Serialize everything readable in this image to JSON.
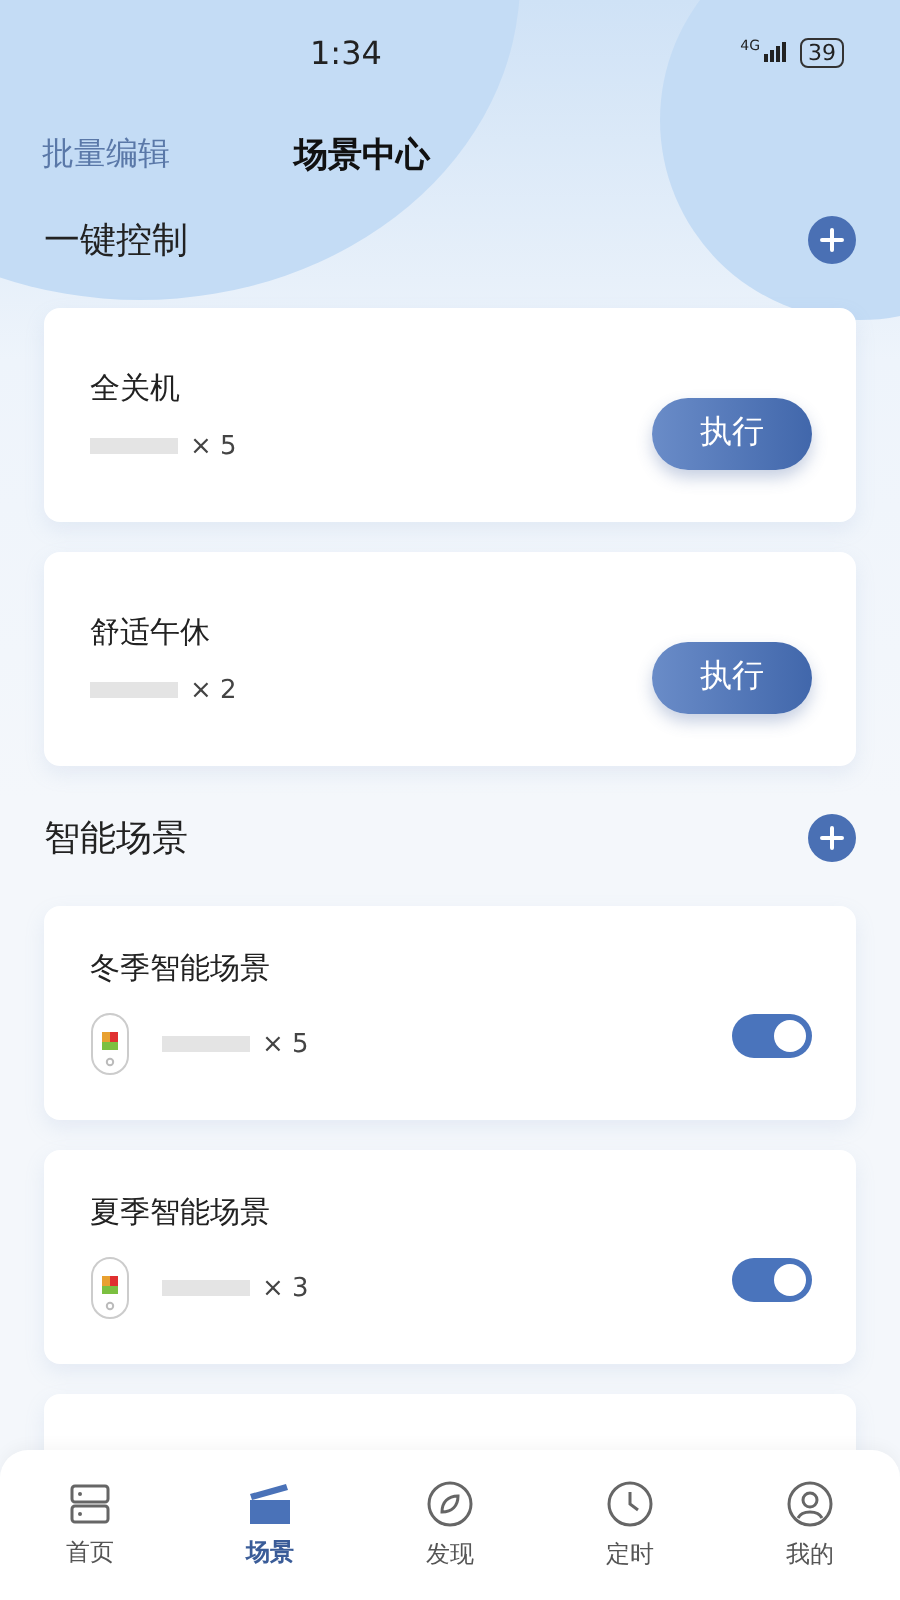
{
  "status_bar": {
    "time": "1:34",
    "network": "4G",
    "battery": "39"
  },
  "header": {
    "left_action": "批量编辑",
    "title": "场景中心"
  },
  "sections": [
    {
      "title": "一键控制",
      "kind": "action",
      "scenes": [
        {
          "name": "全关机",
          "count": "× 5",
          "button": "执行"
        },
        {
          "name": "舒适午休",
          "count": "× 2",
          "button": "执行"
        }
      ]
    },
    {
      "title": "智能场景",
      "kind": "toggle",
      "scenes": [
        {
          "name": "冬季智能场景",
          "count": "× 5",
          "on": true
        },
        {
          "name": "夏季智能场景",
          "count": "× 3",
          "on": true
        }
      ]
    }
  ],
  "tabs": [
    {
      "label": "首页",
      "kind": "home",
      "selected": false
    },
    {
      "label": "场景",
      "kind": "scene",
      "selected": true
    },
    {
      "label": "发现",
      "kind": "discover",
      "selected": false
    },
    {
      "label": "定时",
      "kind": "clock",
      "selected": false
    },
    {
      "label": "我的",
      "kind": "user",
      "selected": false
    }
  ]
}
